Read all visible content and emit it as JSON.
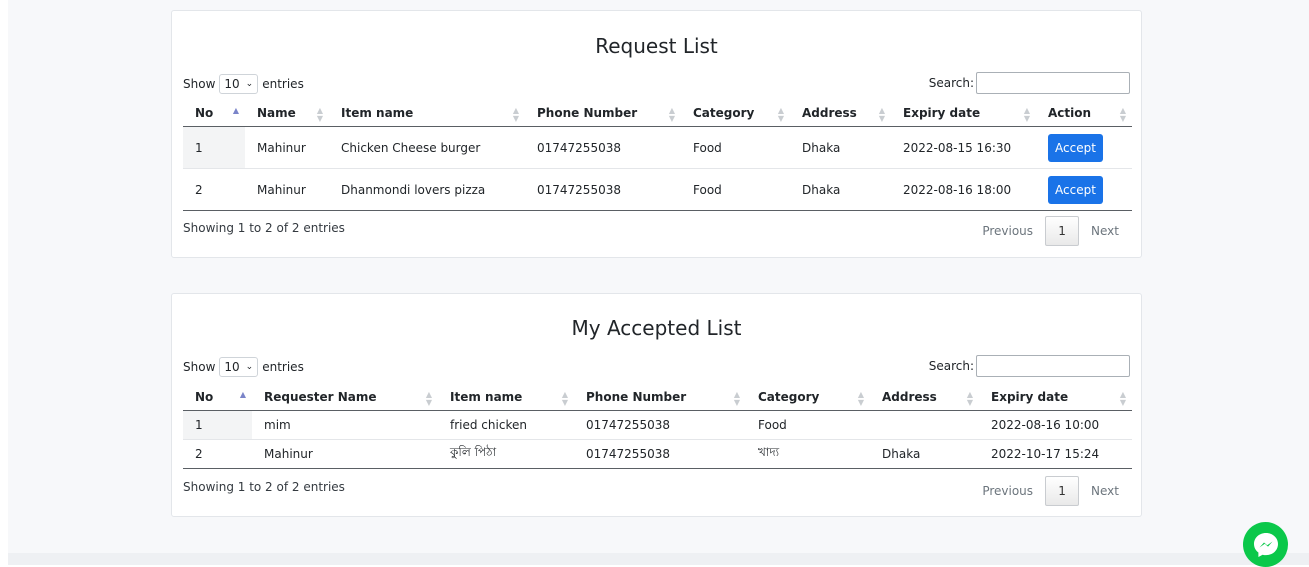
{
  "request_list": {
    "title": "Request List",
    "show_label": "Show",
    "entries_label": "entries",
    "page_length": "10",
    "search_label": "Search:",
    "search_value": "",
    "columns": [
      "No",
      "Name",
      "Item name",
      "Phone Number",
      "Category",
      "Address",
      "Expiry date",
      "Action"
    ],
    "rows": [
      {
        "no": "1",
        "name": "Mahinur",
        "item": "Chicken Cheese burger",
        "phone": "01747255038",
        "category": "Food",
        "address": "Dhaka",
        "expiry": "2022-08-15 16:30",
        "action": "Accept"
      },
      {
        "no": "2",
        "name": "Mahinur",
        "item": "Dhanmondi lovers pizza",
        "phone": "01747255038",
        "category": "Food",
        "address": "Dhaka",
        "expiry": "2022-08-16 18:00",
        "action": "Accept"
      }
    ],
    "info": "Showing 1 to 2 of 2 entries",
    "pagination": {
      "previous": "Previous",
      "current": "1",
      "next": "Next"
    }
  },
  "accepted_list": {
    "title": "My Accepted List",
    "show_label": "Show",
    "entries_label": "entries",
    "page_length": "10",
    "search_label": "Search:",
    "search_value": "",
    "columns": [
      "No",
      "Requester Name",
      "Item name",
      "Phone Number",
      "Category",
      "Address",
      "Expiry date"
    ],
    "rows": [
      {
        "no": "1",
        "name": "mim",
        "item": "fried chicken",
        "phone": "01747255038",
        "category": "Food",
        "address": "",
        "expiry": "2022-08-16 10:00"
      },
      {
        "no": "2",
        "name": "Mahinur",
        "item": "কুলি পিঠা",
        "phone": "01747255038",
        "category": "খাদ্য",
        "address": "Dhaka",
        "expiry": "2022-10-17 15:24"
      }
    ],
    "info": "Showing 1 to 2 of 2 entries",
    "pagination": {
      "previous": "Previous",
      "current": "1",
      "next": "Next"
    }
  },
  "colors": {
    "accept_button": "#1a73e8",
    "messenger": "#0bc84a"
  },
  "icons": {
    "messenger": "messenger-icon",
    "sort": "sort-icon",
    "dropdown": "chevron-down-icon"
  }
}
